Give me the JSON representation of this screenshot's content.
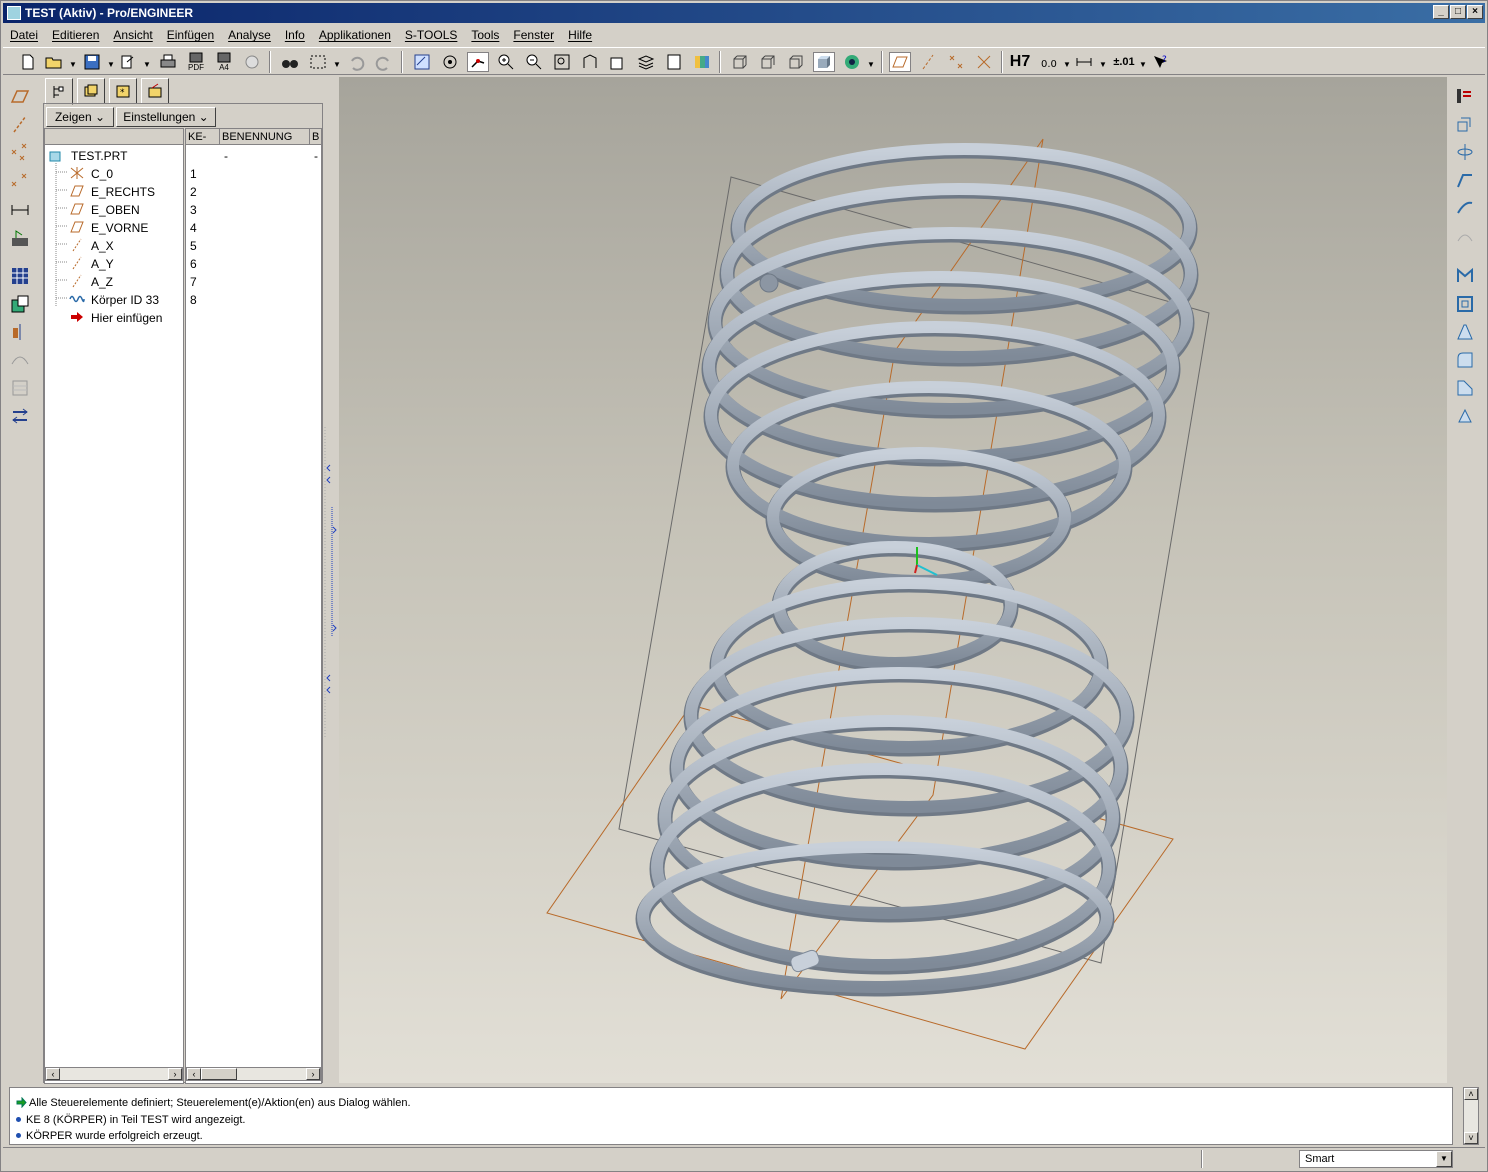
{
  "window": {
    "title": "TEST (Aktiv) - Pro/ENGINEER",
    "controls": [
      "_",
      "□",
      "×"
    ]
  },
  "menu": [
    "Datei",
    "Editieren",
    "Ansicht",
    "Einfügen",
    "Analyse",
    "Info",
    "Applikationen",
    "S-TOOLS",
    "Tools",
    "Fenster",
    "Hilfe"
  ],
  "toolbar": {
    "tolerance_label": "±.01",
    "h7_label": "H7",
    "pdf_label": "PDF",
    "a4_label": "A4"
  },
  "model_tree": {
    "show_button": "Zeigen",
    "settings_button": "Einstellungen",
    "columns": [
      "KE-Nr.",
      "BENENNUNG",
      "B"
    ],
    "root": {
      "name": "TEST.PRT",
      "number": "",
      "benennung": "-",
      "b": "-"
    },
    "items": [
      {
        "name": "C_0",
        "number": "1",
        "icon": "csys-icon"
      },
      {
        "name": "E_RECHTS",
        "number": "2",
        "icon": "datum-plane-icon"
      },
      {
        "name": "E_OBEN",
        "number": "3",
        "icon": "datum-plane-icon"
      },
      {
        "name": "E_VORNE",
        "number": "4",
        "icon": "datum-plane-icon"
      },
      {
        "name": "A_X",
        "number": "5",
        "icon": "datum-axis-icon"
      },
      {
        "name": "A_Y",
        "number": "6",
        "icon": "datum-axis-icon"
      },
      {
        "name": "A_Z",
        "number": "7",
        "icon": "datum-axis-icon"
      },
      {
        "name": "Körper ID 33",
        "number": "8",
        "icon": "coil-feature-icon"
      },
      {
        "name": "Hier einfügen",
        "number": "",
        "icon": "insert-arrow-icon"
      }
    ]
  },
  "messages": [
    {
      "text": "Alle Steuerelemente definiert; Steuerelement(e)/Aktion(en) aus Dialog wählen.",
      "icon": "green-arrow-icon"
    },
    {
      "text": "KE 8 (KÖRPER) in Teil TEST wird angezeigt.",
      "icon": "bullet-icon"
    },
    {
      "text": "KÖRPER wurde erfolgreich erzeugt.",
      "icon": "bullet-icon"
    }
  ],
  "status": {
    "filter_value": "Smart"
  },
  "colors": {
    "titlebar": "#0a246a",
    "spring": "#9aa4b0",
    "datum_plane": "#b86a2a",
    "viewport_bg": "#c6c3b8"
  }
}
